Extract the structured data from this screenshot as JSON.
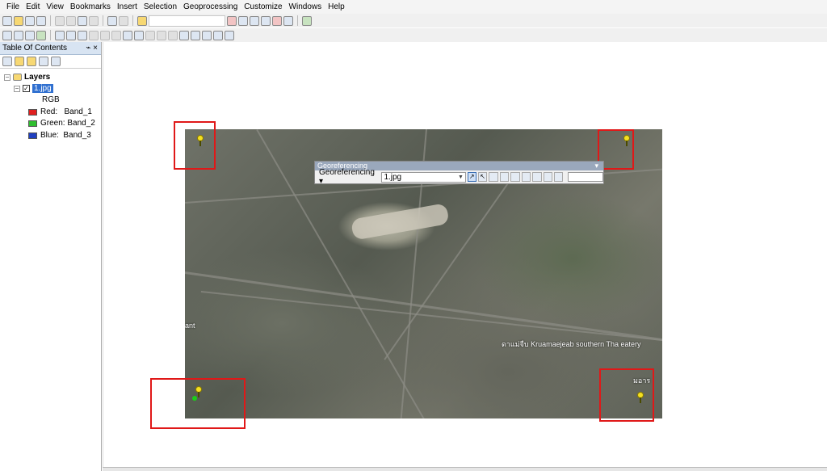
{
  "menu": [
    "File",
    "Edit",
    "View",
    "Bookmarks",
    "Insert",
    "Selection",
    "Geoprocessing",
    "Customize",
    "Windows",
    "Help"
  ],
  "toc": {
    "title": "Table Of Contents",
    "pin": "⌁",
    "close": "×",
    "root_label": "Layers",
    "layer_label": "1.jpg",
    "rgb_label": "RGB",
    "bands": [
      {
        "label": "Red:   Band_1",
        "color": "#e02020"
      },
      {
        "label": "Green: Band_2",
        "color": "#2fbf2f"
      },
      {
        "label": "Blue:  Band_3",
        "color": "#2040c0"
      }
    ]
  },
  "georeferencing": {
    "title": "Georeferencing",
    "menu_label": "Georeferencing ▾",
    "layer_value": "1.jpg",
    "close": "▾"
  },
  "image_labels": {
    "left": "ant",
    "bottom_right": "ดาแม่จืบ Kruamaejeab southern Tha eatery",
    "right_edge": "มอาร"
  },
  "colors": {
    "highlight": "#e01818",
    "marker": "#f5e021"
  }
}
